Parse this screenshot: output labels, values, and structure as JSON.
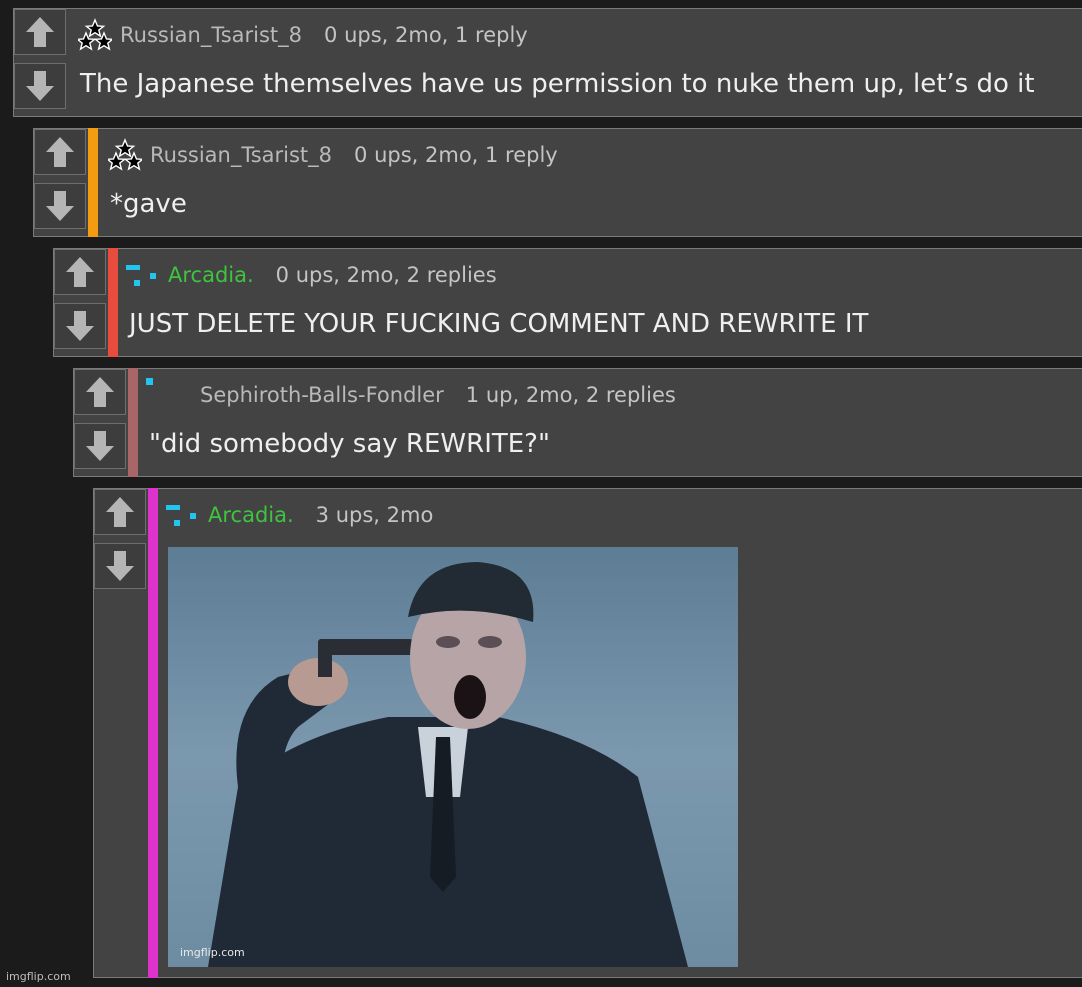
{
  "comments": [
    {
      "username": "Russian_Tsarist_8",
      "meta": "0 ups, 2mo, 1 reply",
      "body": "The Japanese themselves have us permission to nuke them up, let’s do it",
      "flair": "three-stars-icon",
      "thread_color": ""
    },
    {
      "username": "Russian_Tsarist_8",
      "meta": "0 ups, 2mo, 1 reply",
      "body": "*gave",
      "flair": "three-stars-icon",
      "thread_color": "#f39c12"
    },
    {
      "username": "Arcadia.",
      "meta": "0 ups, 2mo, 2 replies",
      "body": "JUST DELETE YOUR FUCKING COMMENT AND REWRITE IT",
      "flair": "pixel-dots-icon",
      "thread_color": "#e74c3c"
    },
    {
      "username": "Sephiroth-Balls-Fondler",
      "meta": "1 up, 2mo, 2 replies",
      "body": "\"did somebody say REWRITE?\"",
      "flair": "single-dot-icon",
      "thread_color": "#a96666"
    },
    {
      "username": "Arcadia.",
      "meta": "3 ups, 2mo",
      "body": "",
      "flair": "pixel-dots-icon",
      "thread_color": "#dd33cc",
      "image_watermark": "imgflip.com"
    }
  ],
  "page_watermark": "imgflip.com",
  "colors": {
    "background": "#1b1b1b",
    "panel": "#434343",
    "green_user": "#3ec43e",
    "flair_blue": "#22c4f0"
  }
}
